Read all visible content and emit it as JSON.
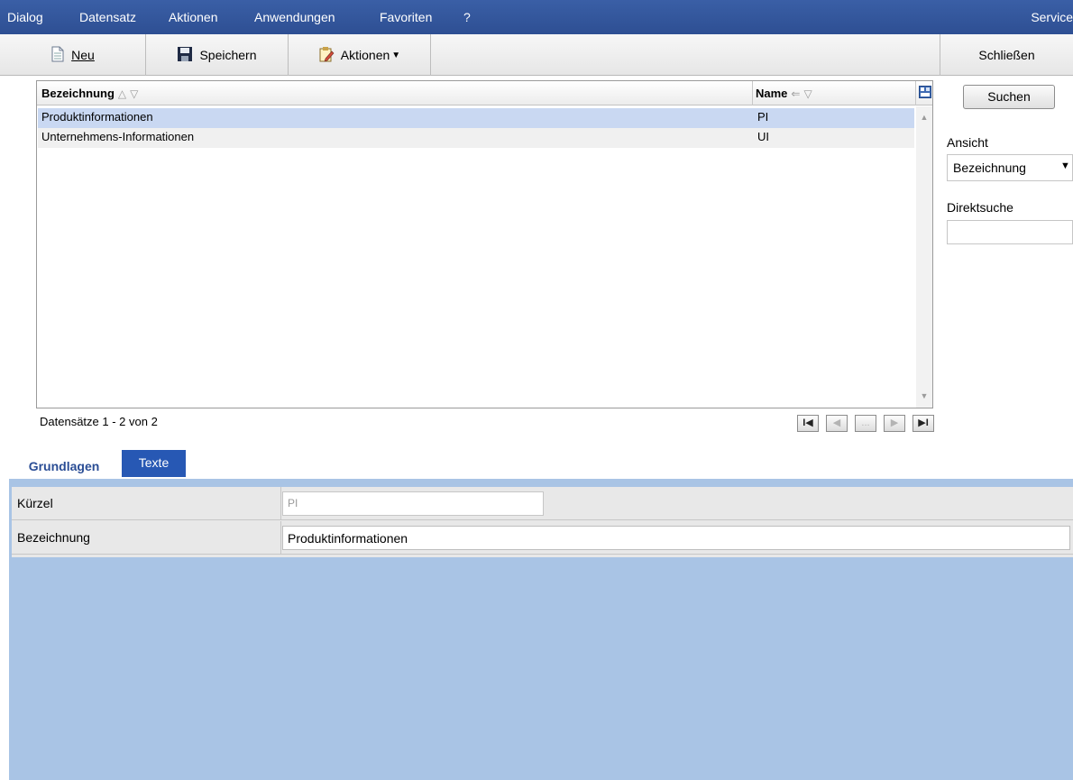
{
  "menu": {
    "items": [
      {
        "label": "Dialog"
      },
      {
        "label": "Datensatz"
      },
      {
        "label": "Aktionen"
      },
      {
        "label": "Anwendungen"
      },
      {
        "label": "Favoriten"
      },
      {
        "label": "?"
      }
    ],
    "right_label": "Service"
  },
  "toolbar": {
    "new_label": "Neu",
    "save_label": "Speichern",
    "actions_label": "Aktionen",
    "close_label": "Schließen"
  },
  "grid": {
    "columns": [
      "Bezeichnung",
      "Name"
    ],
    "rows": [
      {
        "bezeichnung": "Produktinformationen",
        "name": "PI",
        "selected": true
      },
      {
        "bezeichnung": "Unternehmens-Informationen",
        "name": "UI",
        "selected": false
      }
    ],
    "record_count": "Datensätze 1 - 2 von 2",
    "pager": {
      "first": "I◀",
      "prev": "◀",
      "more": "...",
      "next": "▶",
      "last": "▶I"
    }
  },
  "side": {
    "search_label": "Suchen",
    "view_label": "Ansicht",
    "view_value": "Bezeichnung",
    "direct_search_label": "Direktsuche",
    "direct_search_value": ""
  },
  "detail": {
    "tabs": [
      {
        "label": "Grundlagen",
        "active": true
      },
      {
        "label": "Texte",
        "active": false
      }
    ],
    "fields": {
      "kuerzel_label": "Kürzel",
      "kuerzel_value": "PI",
      "bezeichnung_label": "Bezeichnung",
      "bezeichnung_value": "Produktinformationen"
    }
  },
  "colors": {
    "menubar": "#2e4f93",
    "selection": "#c9d8f2",
    "detail_background": "#a9c4e5",
    "tab_active_text": "#2a4d95",
    "tab_inactive_bg": "#2758b4"
  }
}
